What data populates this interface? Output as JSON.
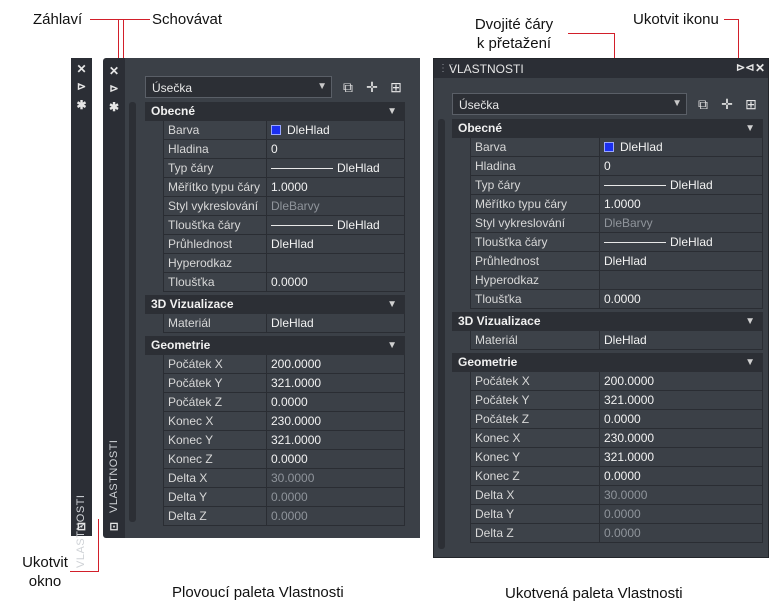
{
  "annotations": {
    "header": "Záhlaví",
    "hide": "Schovávat",
    "double_lines_1": "Dvojité čáry",
    "double_lines_2": "k přetažení",
    "dock_icon": "Ukotvit ikonu",
    "dock_window_1": "Ukotvit",
    "dock_window_2": "okno",
    "caption_float": "Plovoucí  paleta Vlastnosti",
    "caption_dock": "Ukotvená paleta Vlastnosti"
  },
  "palette": {
    "title": "VLASTNOSTI",
    "object_type": "Úsečka",
    "toolbar": [
      "select-objects-icon",
      "pick-point-icon",
      "quick-select-icon"
    ],
    "sections": [
      {
        "title": "Obecné",
        "rows": [
          {
            "name": "Barva",
            "value": "DleHlad",
            "kind": "color",
            "color": "#1b2ff0"
          },
          {
            "name": "Hladina",
            "value": "0"
          },
          {
            "name": "Typ čáry",
            "value": "DleHlad",
            "kind": "line"
          },
          {
            "name": "Měřítko typu čáry",
            "value": "1.0000"
          },
          {
            "name": "Styl vykreslování",
            "value": "DleBarvy",
            "dim": true
          },
          {
            "name": "Tloušťka čáry",
            "value": "DleHlad",
            "kind": "line"
          },
          {
            "name": "Průhlednost",
            "value": "DleHlad"
          },
          {
            "name": "Hyperodkaz",
            "value": ""
          },
          {
            "name": "Tloušťka",
            "value": "0.0000"
          }
        ]
      },
      {
        "title": "3D Vizualizace",
        "rows": [
          {
            "name": "Materiál",
            "value": "DleHlad"
          }
        ]
      },
      {
        "title": "Geometrie",
        "rows": [
          {
            "name": "Počátek X",
            "value": "200.0000"
          },
          {
            "name": "Počátek Y",
            "value": "321.0000"
          },
          {
            "name": "Počátek Z",
            "value": "0.0000"
          },
          {
            "name": "Konec X",
            "value": "230.0000"
          },
          {
            "name": "Konec Y",
            "value": "321.0000"
          },
          {
            "name": "Konec Z",
            "value": "0.0000"
          },
          {
            "name": "Delta X",
            "value": "30.0000",
            "dim": true
          },
          {
            "name": "Delta Y",
            "value": "0.0000",
            "dim": true
          },
          {
            "name": "Delta Z",
            "value": "0.0000",
            "dim": true
          }
        ]
      }
    ]
  }
}
